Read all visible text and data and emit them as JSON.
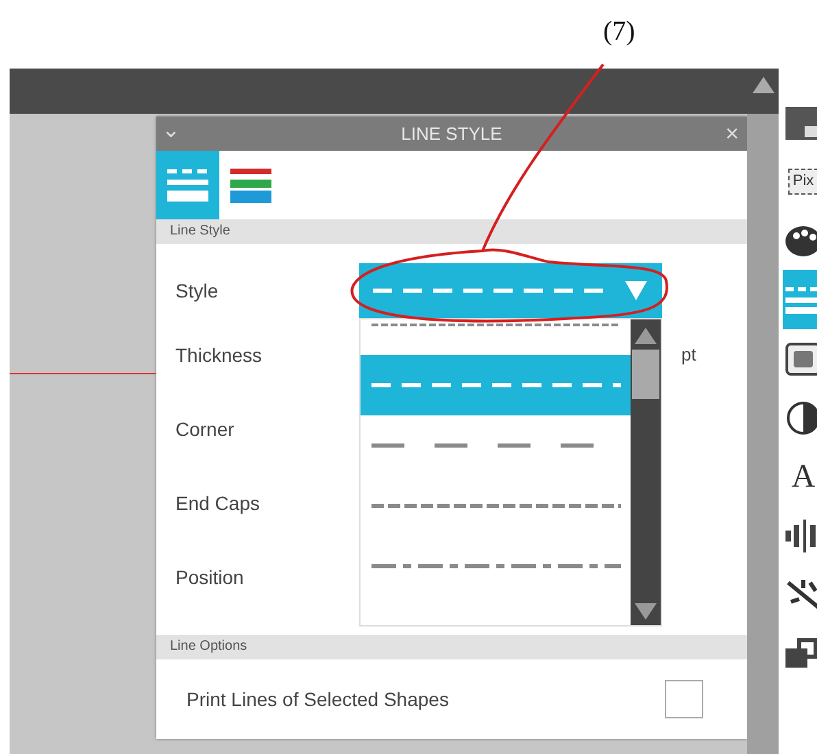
{
  "annotation": {
    "label": "(7)"
  },
  "panel": {
    "title": "LINE STYLE",
    "collapse_icon": "⌄",
    "close_icon": "×",
    "tabs": [
      {
        "kind": "lines",
        "selected": true
      },
      {
        "kind": "colors",
        "selected": false
      }
    ],
    "section_1": "Line Style",
    "rows": [
      {
        "label": "Style"
      },
      {
        "label": "Thickness",
        "unit": "pt"
      },
      {
        "label": "Corner"
      },
      {
        "label": "End Caps"
      },
      {
        "label": "Position"
      }
    ],
    "style_dropdown": {
      "value": {
        "kind": "dash"
      },
      "expanded": true,
      "options": [
        {
          "kind": "fine",
          "selected": false
        },
        {
          "kind": "dash",
          "selected": true
        },
        {
          "kind": "long",
          "selected": false
        },
        {
          "kind": "medium",
          "selected": false
        },
        {
          "kind": "dashdot",
          "selected": false
        }
      ]
    },
    "section_2": "Line Options",
    "options": [
      {
        "label": "Print Lines of Selected Shapes",
        "checked": false
      }
    ]
  },
  "toolbar": [
    {
      "kind": "page",
      "selected": false
    },
    {
      "kind": "pix",
      "label": "Pix",
      "selected": false
    },
    {
      "kind": "palette",
      "selected": false
    },
    {
      "kind": "lines",
      "selected": true
    },
    {
      "kind": "image",
      "selected": false
    },
    {
      "kind": "contrast",
      "selected": false
    },
    {
      "kind": "text",
      "label": "A",
      "selected": false
    },
    {
      "kind": "align",
      "selected": false
    },
    {
      "kind": "trace",
      "selected": false
    },
    {
      "kind": "replicate",
      "selected": false
    }
  ]
}
